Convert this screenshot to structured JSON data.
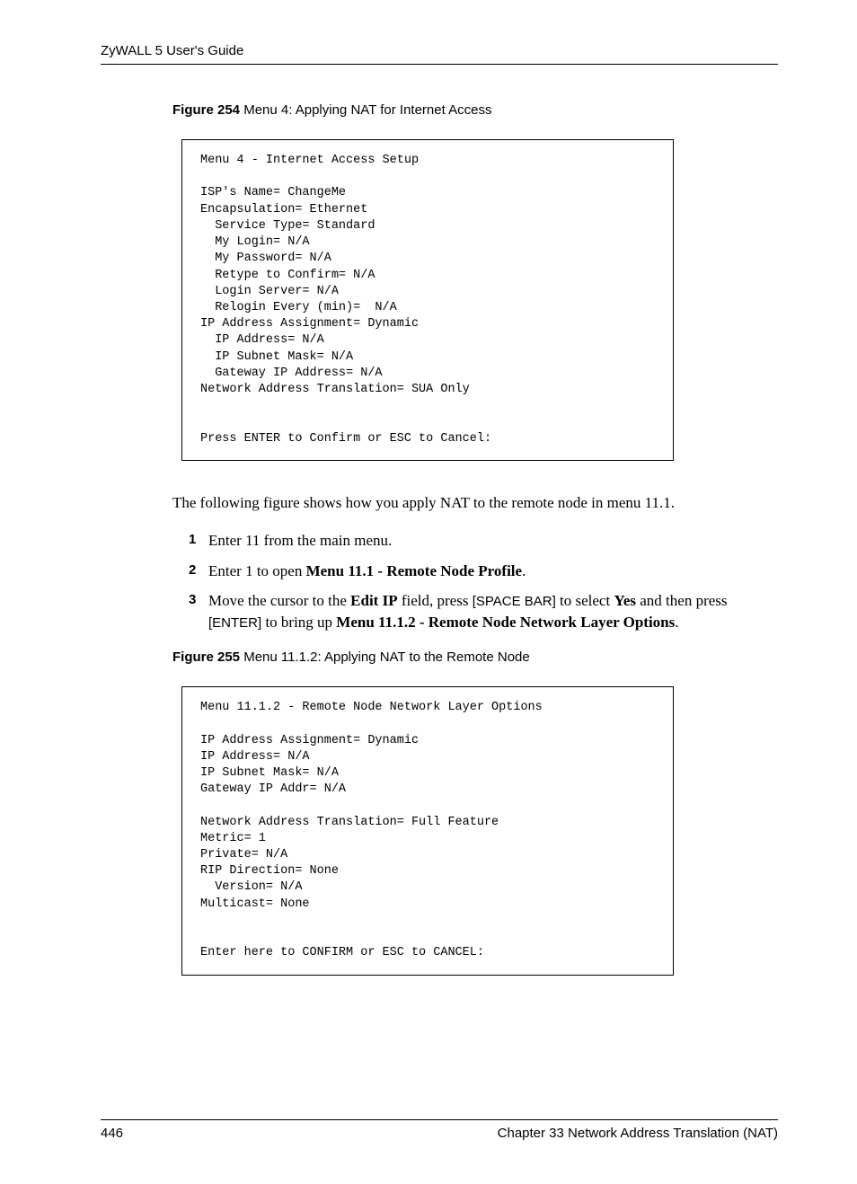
{
  "header": {
    "left": "ZyWALL 5 User's Guide",
    "right": ""
  },
  "fig1": {
    "label": "Figure 254",
    "caption": "   Menu 4: Applying NAT for Internet Access",
    "code": "Menu 4 - Internet Access Setup\n\nISP's Name= ChangeMe\nEncapsulation= Ethernet\n  Service Type= Standard\n  My Login= N/A\n  My Password= N/A\n  Retype to Confirm= N/A\n  Login Server= N/A\n  Relogin Every (min)=  N/A\nIP Address Assignment= Dynamic\n  IP Address= N/A\n  IP Subnet Mask= N/A\n  Gateway IP Address= N/A\nNetwork Address Translation= SUA Only\n\n\nPress ENTER to Confirm or ESC to Cancel:"
  },
  "para1": "The following figure shows how you apply NAT to the remote node in menu 11.1.",
  "steps": [
    {
      "num": "1",
      "text_a": "Enter 11 from the main menu."
    },
    {
      "num": "2",
      "text_a": "Enter 1 to open ",
      "bold_a": "Menu 11.1 - Remote Node Profile",
      "text_b": "."
    },
    {
      "num": "3",
      "text_a": "Move the cursor to the ",
      "bold_a": "Edit IP",
      "text_b": " field, press ",
      "key1": "[SPACE BAR]",
      "text_c": " to select ",
      "bold_b": "Yes",
      "text_d": " and then press ",
      "key2": "[ENTER]",
      "text_e": " to bring up ",
      "bold_c": "Menu 11.1.2 - Remote Node Network Layer Options",
      "text_f": "."
    }
  ],
  "fig2": {
    "label": "Figure 255",
    "caption": "   Menu 11.1.2: Applying NAT to the Remote Node",
    "code": "Menu 11.1.2 - Remote Node Network Layer Options\n\nIP Address Assignment= Dynamic\nIP Address= N/A\nIP Subnet Mask= N/A\nGateway IP Addr= N/A\n\nNetwork Address Translation= Full Feature\nMetric= 1\nPrivate= N/A\nRIP Direction= None\n  Version= N/A\nMulticast= None\n\n\nEnter here to CONFIRM or ESC to CANCEL:"
  },
  "footer": {
    "left": "446",
    "right": "Chapter 33 Network Address Translation (NAT)"
  }
}
